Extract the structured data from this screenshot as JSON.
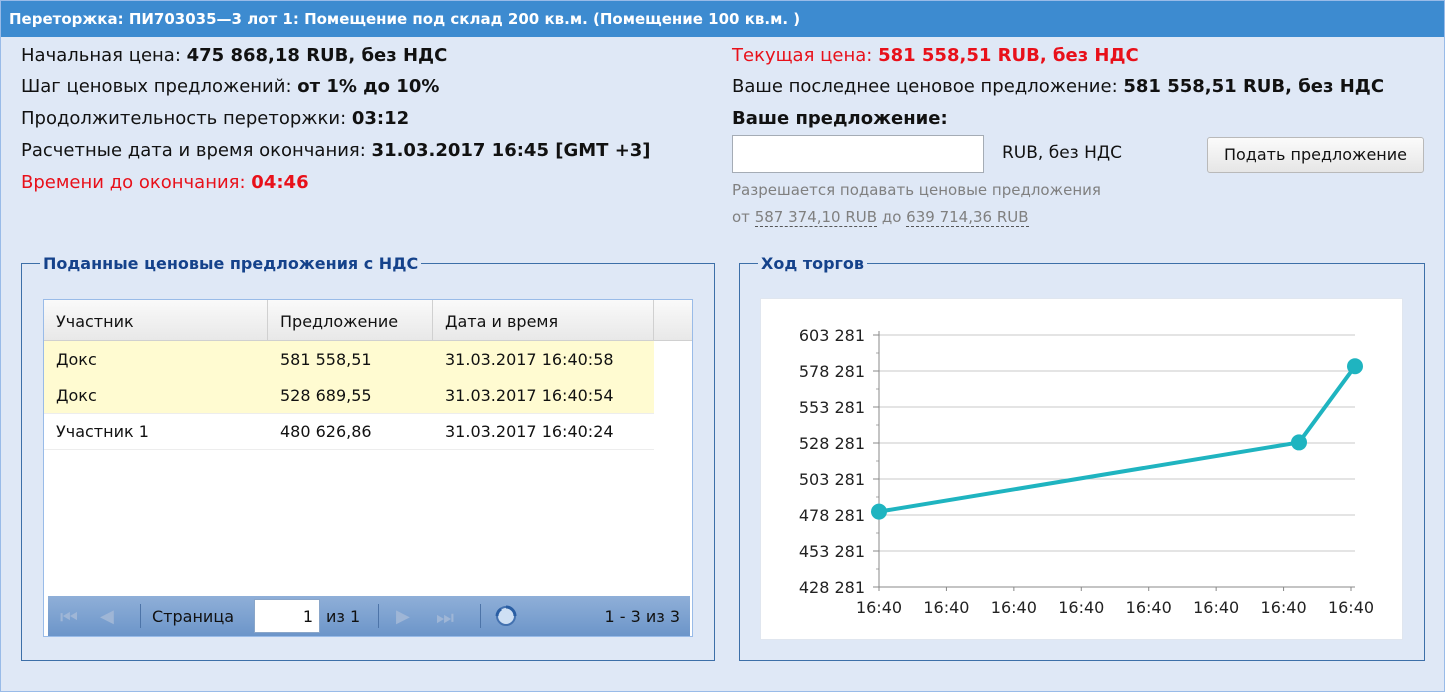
{
  "title": "Переторжка: ПИ703035—3 лот 1: Помещение под склад 200 кв.м. (Помещение 100 кв.м. )",
  "info": {
    "start_price_label": "Начальная цена:",
    "start_price_value": "475 868,18 RUB, без НДС",
    "step_label": "Шаг ценовых предложений:",
    "step_value": "от 1% до 10%",
    "duration_label": "Продолжительность переторжки:",
    "duration_value": "03:12",
    "end_label": "Расчетные дата и время окончания:",
    "end_value": "31.03.2017 16:45 [GMT +3]",
    "remaining_label": "Времени до окончания:",
    "remaining_value": "04:46"
  },
  "current": {
    "current_label": "Текущая цена:",
    "current_value": "581 558,51 RUB, без НДС",
    "last_label": "Ваше последнее ценовое предложение:",
    "last_value": "581 558,51 RUB, без НДС",
    "offer_label": "Ваше предложение:",
    "offer_input_value": "",
    "offer_unit": "RUB, без НДС",
    "submit_label": "Подать предложение",
    "hint_line1": "Разрешается подавать ценовые предложения",
    "hint_from_prefix": "от",
    "hint_from": "587 374,10 RUB",
    "hint_to_prefix": "до",
    "hint_to": "639 714,36 RUB"
  },
  "bids_panel": {
    "legend": "Поданные ценовые предложения с НДС",
    "columns": [
      "Участник",
      "Предложение",
      "Дата и время"
    ],
    "rows": [
      {
        "participant": "Докс",
        "offer": "581 558,51",
        "datetime": "31.03.2017 16:40:58",
        "highlight": true
      },
      {
        "participant": "Докс",
        "offer": "528 689,55",
        "datetime": "31.03.2017 16:40:54",
        "highlight": true
      },
      {
        "participant": "Участник 1",
        "offer": "480 626,86",
        "datetime": "31.03.2017 16:40:24",
        "highlight": false
      }
    ],
    "pager": {
      "page_label": "Страница",
      "page_value": "1",
      "of_label": "из 1",
      "summary": "1 - 3 из 3"
    }
  },
  "chart_panel": {
    "legend": "Ход торгов"
  },
  "chart_data": {
    "type": "line",
    "title": "",
    "xlabel": "",
    "ylabel": "",
    "x_tick_labels": [
      "16:40",
      "16:40",
      "16:40",
      "16:40",
      "16:40",
      "16:40",
      "16:40",
      "16:40"
    ],
    "y_ticks": [
      428281,
      453281,
      478281,
      503281,
      528281,
      553281,
      578281,
      603281
    ],
    "y_tick_labels": [
      "428 281",
      "453 281",
      "478 281",
      "503 281",
      "528 281",
      "553 281",
      "578 281",
      "603 281"
    ],
    "ylim": [
      428281,
      603281
    ],
    "xlim": [
      "16:40:24",
      "16:40:58"
    ],
    "grid": true,
    "series": [
      {
        "color": "#1fb4c0",
        "x": [
          "16:40:24",
          "16:40:54",
          "16:40:58"
        ],
        "values": [
          480626.86,
          528689.55,
          581558.51
        ]
      }
    ]
  }
}
